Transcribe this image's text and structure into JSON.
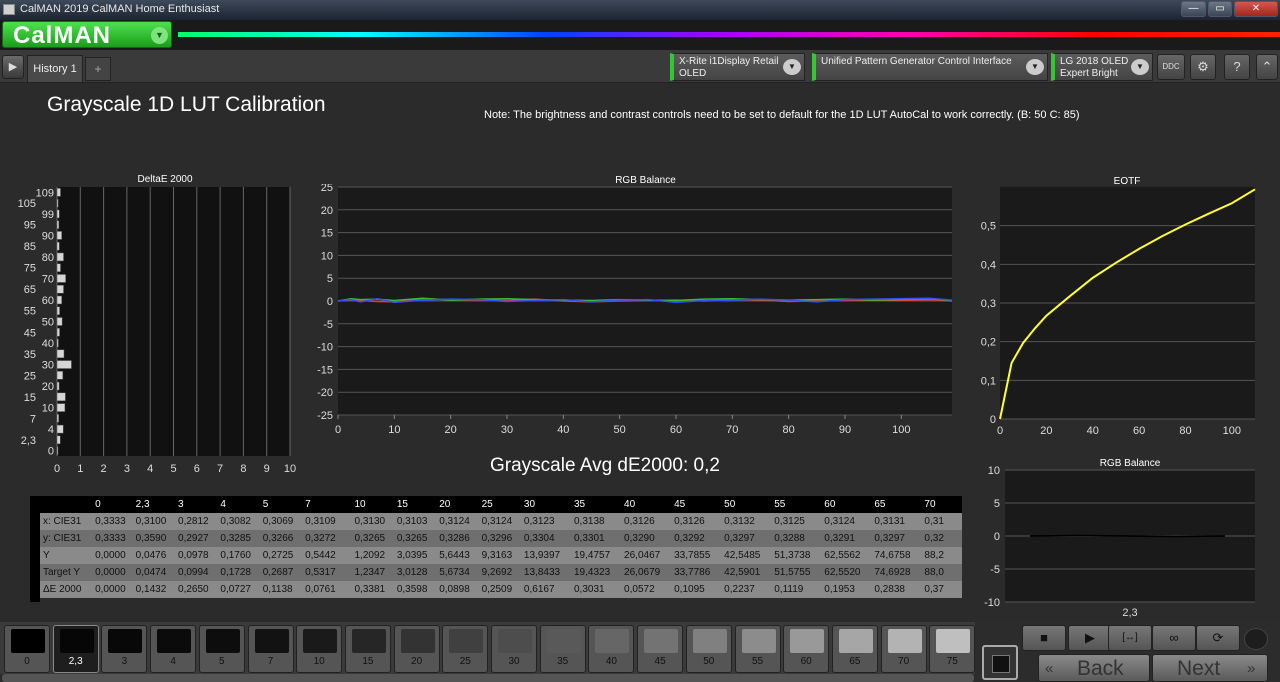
{
  "window": {
    "title": "CalMAN 2019 CalMAN Home Enthusiast",
    "min": "—",
    "max": "▭",
    "close": "✕"
  },
  "logo": {
    "text": "CalMAN"
  },
  "tabs": {
    "history": "History 1",
    "add": "+"
  },
  "devices": {
    "meter": {
      "line1": "X-Rite i1Display Retail",
      "line2": "OLED"
    },
    "generator": {
      "line1": "Unified Pattern Generator Control Interface",
      "line2": ""
    },
    "display": {
      "line1": "LG 2018 OLED",
      "line2": "Expert Bright"
    }
  },
  "toolbar_icons": [
    "ddc-icon",
    "gear-icon",
    "help-icon",
    "chevron-up-icon"
  ],
  "page": {
    "title": "Grayscale  1D LUT Calibration",
    "note": "Note: The brightness and contrast controls need to be set to default for the 1D LUT AutoCal to work correctly.  (B: 50 C: 85)",
    "avg_label": "Grayscale Avg dE2000: 0,2"
  },
  "colors": {
    "accent": "#35c535",
    "bar": "#d6d6d6",
    "eotf": "#ffff33",
    "grid": "#555555"
  },
  "chart_data": [
    {
      "type": "bar",
      "title": "DeltaE 2000",
      "orientation": "horizontal",
      "categories": [
        "0",
        "2,3",
        "4",
        "7",
        "10",
        "15",
        "20",
        "25",
        "30",
        "35",
        "40",
        "45",
        "50",
        "55",
        "60",
        "65",
        "70",
        "75",
        "80",
        "85",
        "90",
        "95",
        "99",
        "105",
        "109"
      ],
      "values": [
        0.0,
        0.14,
        0.27,
        0.07,
        0.34,
        0.36,
        0.09,
        0.25,
        0.62,
        0.3,
        0.06,
        0.11,
        0.22,
        0.11,
        0.2,
        0.28,
        0.37,
        0.15,
        0.28,
        0.1,
        0.2,
        0.08,
        0.1,
        0.05,
        0.15
      ],
      "xlim": [
        0,
        10
      ],
      "xticks": [
        "0",
        "1",
        "2",
        "3",
        "4",
        "5",
        "6",
        "7",
        "8",
        "9",
        "10"
      ]
    },
    {
      "type": "line",
      "title": "RGB Balance",
      "ylim": [
        -25,
        25
      ],
      "yticks": [
        "25",
        "20",
        "15",
        "10",
        "5",
        "0",
        "-5",
        "-10",
        "-15",
        "-20",
        "-25"
      ],
      "xlim": [
        0,
        109
      ],
      "xticks": [
        "0",
        "10",
        "20",
        "30",
        "40",
        "50",
        "60",
        "70",
        "80",
        "90",
        "100"
      ],
      "x": [
        0,
        2.3,
        4,
        7,
        10,
        15,
        20,
        25,
        30,
        35,
        40,
        45,
        50,
        55,
        60,
        65,
        70,
        75,
        80,
        85,
        90,
        95,
        99,
        105,
        109
      ],
      "series": [
        {
          "color": "#ff3030",
          "values": [
            0,
            0.2,
            0.1,
            -0.1,
            -0.2,
            0.5,
            0.3,
            0.2,
            0.1,
            0.4,
            0.0,
            -0.2,
            0.0,
            0.1,
            0.2,
            0.0,
            0.3,
            0.2,
            -0.1,
            0.0,
            0.1,
            0.2,
            0.1,
            0.3,
            0.0
          ]
        },
        {
          "color": "#30c030",
          "values": [
            0,
            0.5,
            0.3,
            0.4,
            0.1,
            0.6,
            0.2,
            0.4,
            0.5,
            0.3,
            0.2,
            0.1,
            0.3,
            0.2,
            0.1,
            0.4,
            0.5,
            0.3,
            0.2,
            0.3,
            0.4,
            0.2,
            0.3,
            0.5,
            0.1
          ]
        },
        {
          "color": "#3050ff",
          "values": [
            0,
            0.3,
            -0.2,
            0.5,
            -0.3,
            0.2,
            0.4,
            0.3,
            -0.1,
            0.1,
            0.3,
            -0.2,
            0.2,
            0.3,
            -0.3,
            0.1,
            0.2,
            0.4,
            0.2,
            -0.2,
            0.3,
            0.4,
            0.5,
            0.6,
            0.2
          ]
        }
      ]
    },
    {
      "type": "line",
      "title": "EOTF",
      "ylim": [
        0,
        0.6
      ],
      "yticks": [
        "0,5",
        "0,4",
        "0,3",
        "0,2",
        "0,1",
        "0"
      ],
      "xlim": [
        0,
        110
      ],
      "xticks": [
        "0",
        "20",
        "40",
        "60",
        "80",
        "100"
      ],
      "gamma": 2.2,
      "x": [
        0,
        5,
        10,
        15,
        20,
        30,
        40,
        50,
        60,
        70,
        80,
        90,
        100,
        110
      ],
      "values": [
        0,
        0.145,
        0.197,
        0.234,
        0.267,
        0.317,
        0.365,
        0.404,
        0.44,
        0.473,
        0.503,
        0.531,
        0.558,
        0.594
      ]
    },
    {
      "type": "line",
      "title": "RGB Balance",
      "ylim": [
        -10,
        10
      ],
      "yticks": [
        "10",
        "5",
        "0",
        "-5",
        "-10"
      ],
      "xlabel": "2,3",
      "values": [
        0,
        0.1,
        0.0,
        -0.1,
        0.0
      ]
    }
  ],
  "table": {
    "columns": [
      "0",
      "2,3",
      "3",
      "4",
      "5",
      "7",
      "10",
      "15",
      "20",
      "25",
      "30",
      "35",
      "40",
      "45",
      "50",
      "55",
      "60",
      "65",
      "70"
    ],
    "rows": [
      {
        "label": "x: CIE31",
        "values": [
          "0,3333",
          "0,3100",
          "0,2812",
          "0,3082",
          "0,3069",
          "0,3109",
          "0,3130",
          "0,3103",
          "0,3124",
          "0,3124",
          "0,3123",
          "0,3138",
          "0,3126",
          "0,3126",
          "0,3132",
          "0,3125",
          "0,3124",
          "0,3131",
          "0,31"
        ]
      },
      {
        "label": "y: CIE31",
        "values": [
          "0,3333",
          "0,3590",
          "0,2927",
          "0,3285",
          "0,3266",
          "0,3272",
          "0,3265",
          "0,3265",
          "0,3286",
          "0,3296",
          "0,3304",
          "0,3301",
          "0,3290",
          "0,3292",
          "0,3297",
          "0,3288",
          "0,3291",
          "0,3297",
          "0,32"
        ]
      },
      {
        "label": "Y",
        "values": [
          "0,0000",
          "0,0476",
          "0,0978",
          "0,1760",
          "0,2725",
          "0,5442",
          "1,2092",
          "3,0395",
          "5,6443",
          "9,3163",
          "13,9397",
          "19,4757",
          "26,0467",
          "33,7855",
          "42,5485",
          "51,3738",
          "62,5562",
          "74,6758",
          "88,2"
        ]
      },
      {
        "label": "Target Y",
        "values": [
          "0,0000",
          "0,0474",
          "0,0994",
          "0,1728",
          "0,2687",
          "0,5317",
          "1,2347",
          "3,0128",
          "5,6734",
          "9,2692",
          "13,8433",
          "19,4323",
          "26,0679",
          "33,7786",
          "42,5901",
          "51,5755",
          "62,5520",
          "74,6928",
          "88,0"
        ]
      },
      {
        "label": "ΔE 2000",
        "values": [
          "0,0000",
          "0,1432",
          "0,2650",
          "0,0727",
          "0,1138",
          "0,0761",
          "0,3381",
          "0,3598",
          "0,0898",
          "0,2509",
          "0,6167",
          "0,3031",
          "0,0572",
          "0,1095",
          "0,2237",
          "0,1119",
          "0,1953",
          "0,2838",
          "0,37"
        ]
      }
    ]
  },
  "swatches": [
    {
      "label": "0",
      "gray": "#000000"
    },
    {
      "label": "2,3",
      "gray": "#060606",
      "selected": true
    },
    {
      "label": "3",
      "gray": "#080808"
    },
    {
      "label": "4",
      "gray": "#0b0b0b"
    },
    {
      "label": "5",
      "gray": "#0d0d0d"
    },
    {
      "label": "7",
      "gray": "#121212"
    },
    {
      "label": "10",
      "gray": "#1a1a1a"
    },
    {
      "label": "15",
      "gray": "#262626"
    },
    {
      "label": "20",
      "gray": "#333333"
    },
    {
      "label": "25",
      "gray": "#404040"
    },
    {
      "label": "30",
      "gray": "#4d4d4d"
    },
    {
      "label": "35",
      "gray": "#595959"
    },
    {
      "label": "40",
      "gray": "#666666"
    },
    {
      "label": "45",
      "gray": "#737373"
    },
    {
      "label": "50",
      "gray": "#808080"
    },
    {
      "label": "55",
      "gray": "#8c8c8c"
    },
    {
      "label": "60",
      "gray": "#999999"
    },
    {
      "label": "65",
      "gray": "#a6a6a6"
    },
    {
      "label": "70",
      "gray": "#b3b3b3"
    },
    {
      "label": "75",
      "gray": "#bfbfbf"
    }
  ],
  "controls": {
    "stop": "■",
    "play": "▶",
    "loop": "[↔]",
    "infinity": "∞",
    "refresh": "⟳",
    "back": "Back",
    "next": "Next",
    "back_arrows": "«",
    "next_arrows": "»"
  }
}
